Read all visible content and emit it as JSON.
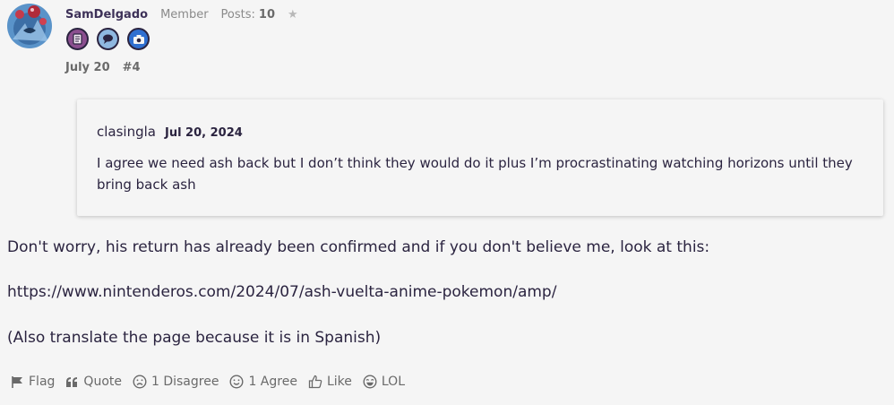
{
  "author": {
    "username": "SamDelgado",
    "role": "Member",
    "posts_label": "Posts:",
    "posts_count": "10",
    "badges": [
      "notebook-badge-icon",
      "speech-bubble-badge-icon",
      "camera-badge-icon"
    ],
    "badge_colors": [
      "#8b4f8f",
      "#8fb8e0",
      "#2f6fd0"
    ]
  },
  "meta": {
    "date": "July 20",
    "post_number": "#4"
  },
  "quote": {
    "author": "clasingla",
    "date": "Jul 20, 2024",
    "text": "I agree we need ash back but I don’t think they would do it plus I’m procrastinating watching horizons until they bring back ash"
  },
  "message": {
    "line1": "Don't worry, his return has already been confirmed and if you don't believe me, look at this:",
    "link": "https://www.nintenderos.com/2024/07/ash-vuelta-anime-pokemon/amp/",
    "line3": "(Also translate the page because it is in Spanish)"
  },
  "actions": {
    "flag": "Flag",
    "quote": "Quote",
    "disagree": "1 Disagree",
    "agree": "1 Agree",
    "like": "Like",
    "lol": "LOL"
  },
  "colors": {
    "background": "#f5f5f5",
    "text": "#2b2440",
    "muted": "#8a8a8a"
  }
}
